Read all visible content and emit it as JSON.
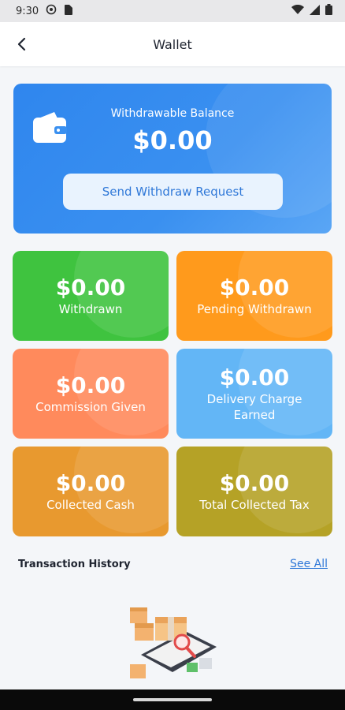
{
  "status_bar": {
    "time": "9:30"
  },
  "header": {
    "title": "Wallet"
  },
  "balance": {
    "label": "Withdrawable Balance",
    "amount": "$0.00",
    "button_label": "Send Withdraw Request"
  },
  "stats": [
    {
      "amount": "$0.00",
      "label": "Withdrawn"
    },
    {
      "amount": "$0.00",
      "label": "Pending Withdrawn"
    },
    {
      "amount": "$0.00",
      "label": "Commission Given"
    },
    {
      "amount": "$0.00",
      "label": "Delivery Charge Earned"
    },
    {
      "amount": "$0.00",
      "label": "Collected Cash"
    },
    {
      "amount": "$0.00",
      "label": "Total Collected Tax"
    }
  ],
  "history": {
    "title": "Transaction History",
    "see_all_label": "See All"
  },
  "colors": {
    "primary": "#2f86ee",
    "withdrawn": "#3fc33f",
    "pending": "#ff9a1c",
    "commission": "#ff8a5c",
    "delivery": "#63b6f6",
    "collected_cash": "#e8992f",
    "tax": "#b5a226"
  },
  "icons": [
    "back-arrow-icon",
    "wallet-icon",
    "wifi-icon",
    "battery-icon",
    "signal-icon",
    "settings-status-icon",
    "sim-status-icon",
    "empty-boxes-illustration"
  ]
}
